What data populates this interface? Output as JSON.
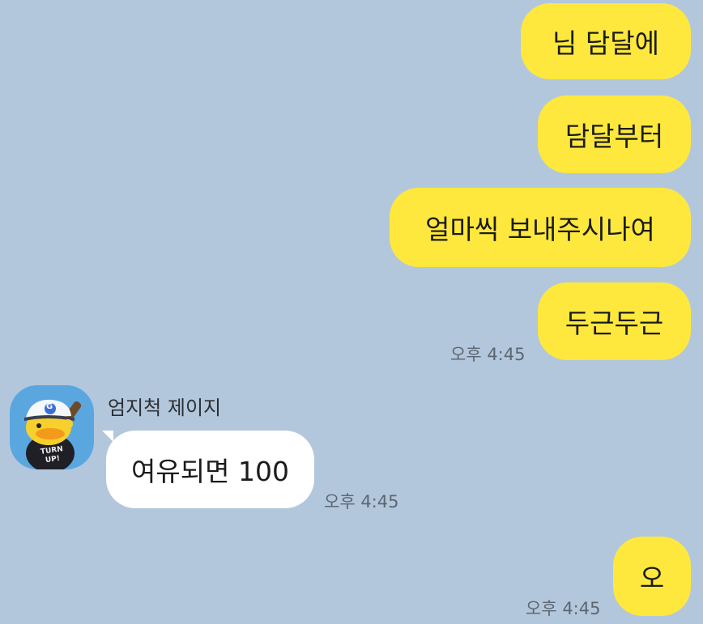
{
  "messages": {
    "m1": "님 담달에",
    "m2": "담달부터",
    "m3": "얼마씩 보내주시나여",
    "m4": "두근두근",
    "m4_time": "오후 4:45",
    "sender_name": "엄지척 제이지",
    "m5": "여유되면 100",
    "m5_time": "오후 4:45",
    "m6": "오",
    "m6_time": "오후 4:45"
  },
  "avatar": {
    "cap_letter": "G",
    "shirt_text_line1": "TURN",
    "shirt_text_line2": "UP!"
  },
  "colors": {
    "background": "#b3c7dc",
    "my_bubble": "#fee83d",
    "other_bubble": "#ffffff",
    "avatar_bg": "#5aa7e0"
  },
  "icons": [
    "expand-icon"
  ]
}
